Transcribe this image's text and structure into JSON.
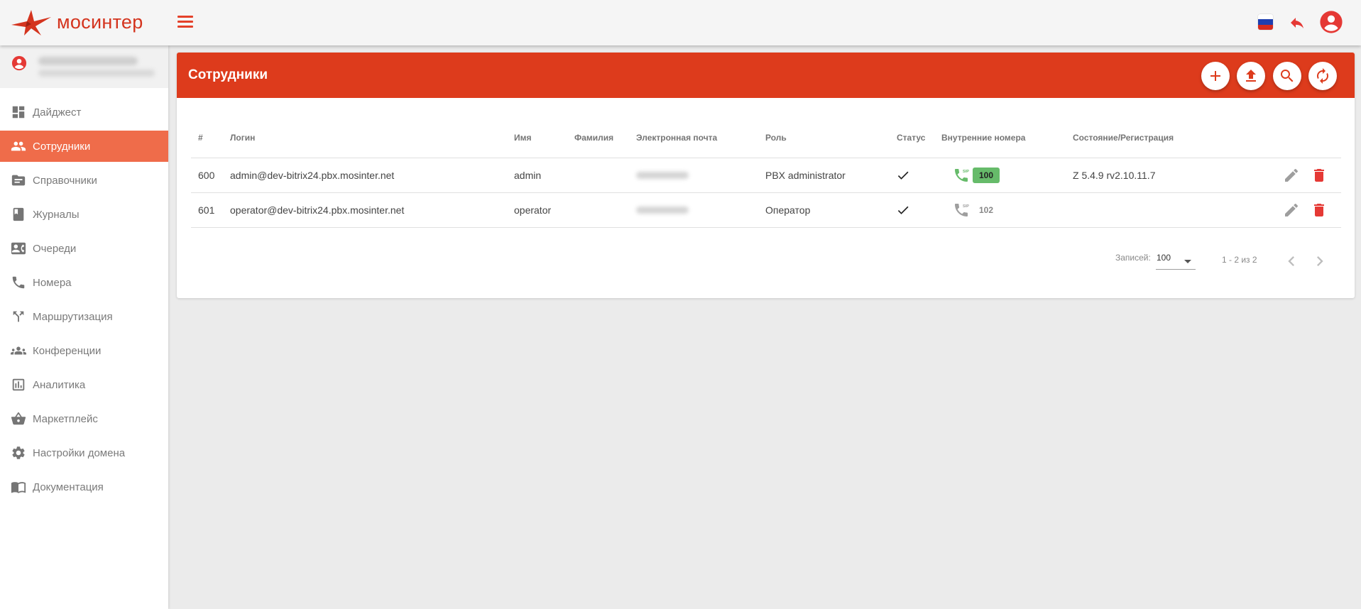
{
  "app": {
    "logo_text": "мосинтер",
    "brand_color": "#dd3b1c",
    "language_flag": "ru-flag-icon"
  },
  "sidebar": {
    "items": [
      {
        "label": "Дайджест",
        "icon": "dashboard-icon",
        "active": false
      },
      {
        "label": "Сотрудники",
        "icon": "people-icon",
        "active": true
      },
      {
        "label": "Справочники",
        "icon": "folder-icon",
        "active": false
      },
      {
        "label": "Журналы",
        "icon": "book-icon",
        "active": false
      },
      {
        "label": "Очереди",
        "icon": "contact-card-icon",
        "active": false
      },
      {
        "label": "Номера",
        "icon": "phone-icon",
        "active": false
      },
      {
        "label": "Маршрутизация",
        "icon": "routing-icon",
        "active": false
      },
      {
        "label": "Конференции",
        "icon": "group-icon",
        "active": false
      },
      {
        "label": "Аналитика",
        "icon": "chart-icon",
        "active": false
      },
      {
        "label": "Маркетплейс",
        "icon": "basket-icon",
        "active": false
      },
      {
        "label": "Настройки домена",
        "icon": "gear-icon",
        "active": false
      },
      {
        "label": "Документация",
        "icon": "docs-icon",
        "active": false
      }
    ]
  },
  "page": {
    "title": "Сотрудники",
    "header_actions": [
      "add-icon",
      "upload-icon",
      "search-icon",
      "refresh-icon"
    ]
  },
  "table": {
    "columns": {
      "num": "#",
      "login": "Логин",
      "name": "Имя",
      "surname": "Фамилия",
      "email": "Электронная почта",
      "role": "Роль",
      "status": "Статус",
      "extensions": "Внутренние номера",
      "registration": "Состояние/Регистрация"
    },
    "rows": [
      {
        "num": "600",
        "login": "admin@dev-bitrix24.pbx.mosinter.net",
        "name": "admin",
        "surname": "",
        "role": "PBX administrator",
        "status": true,
        "extension": "100",
        "extension_registered": true,
        "registration": "Z 5.4.9 rv2.10.11.7"
      },
      {
        "num": "601",
        "login": "operator@dev-bitrix24.pbx.mosinter.net",
        "name": "operator",
        "surname": "",
        "role": "Оператор",
        "status": true,
        "extension": "102",
        "extension_registered": false,
        "registration": ""
      }
    ]
  },
  "pagination": {
    "label": "Записей:",
    "page_size": "100",
    "range": "1 - 2 из 2"
  },
  "colors": {
    "header": "#dd3b1c",
    "active_nav": "#ef6c4a",
    "registered_badge": "#66bb6a",
    "delete": "#e53935"
  }
}
